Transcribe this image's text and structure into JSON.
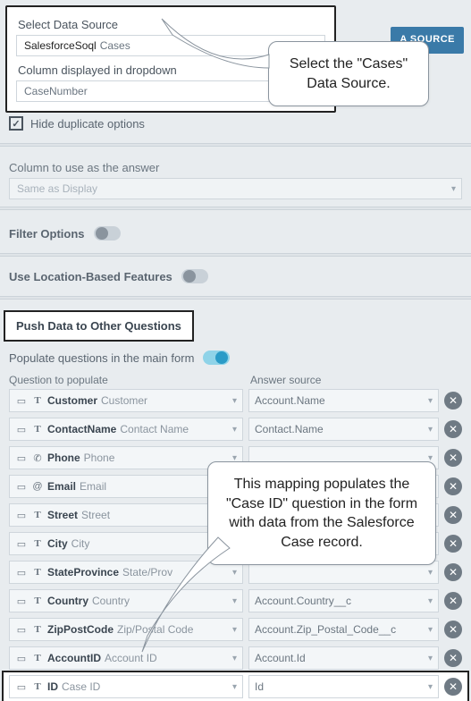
{
  "topbar": {
    "button": "A SOURCE"
  },
  "dataSourcePanel": {
    "label1": "Select Data Source",
    "prefix": "SalesforceSoql",
    "value": "Cases",
    "label2": "Column displayed in dropdown",
    "column": "CaseNumber"
  },
  "hideDup": {
    "label": "Hide duplicate options"
  },
  "answerCol": {
    "label": "Column to use as the answer",
    "value": "Same as Display"
  },
  "filterOptions": {
    "label": "Filter Options"
  },
  "locationFeatures": {
    "label": "Use Location-Based Features"
  },
  "pushTab": {
    "label": "Push Data to Other Questions"
  },
  "populate": {
    "label": "Populate questions in the main form",
    "colL": "Question to populate",
    "colR": "Answer source"
  },
  "mappings": [
    {
      "icon": "T",
      "name": "Customer",
      "sub": "Customer",
      "answer": "Account.Name"
    },
    {
      "icon": "T",
      "name": "ContactName",
      "sub": "Contact Name",
      "answer": "Contact.Name"
    },
    {
      "icon": "phone",
      "name": "Phone",
      "sub": "Phone",
      "answer": ""
    },
    {
      "icon": "@",
      "name": "Email",
      "sub": "Email",
      "answer": ""
    },
    {
      "icon": "T",
      "name": "Street",
      "sub": "Street",
      "answer": ""
    },
    {
      "icon": "T",
      "name": "City",
      "sub": "City",
      "answer": ""
    },
    {
      "icon": "T",
      "name": "StateProvince",
      "sub": "State/Prov",
      "answer": ""
    },
    {
      "icon": "T",
      "name": "Country",
      "sub": "Country",
      "answer": "Account.Country__c"
    },
    {
      "icon": "T",
      "name": "ZipPostCode",
      "sub": "Zip/Postal Code",
      "answer": "Account.Zip_Postal_Code__c"
    },
    {
      "icon": "T",
      "name": "AccountID",
      "sub": "Account ID",
      "answer": "Account.Id"
    },
    {
      "icon": "T",
      "name": "ID",
      "sub": "Case ID",
      "answer": "Id",
      "highlight": true
    }
  ],
  "callout1": "Select the \"Cases\" Data Source.",
  "callout2": "This mapping populates the \"Case ID\" question in the form with data from the Salesforce Case record."
}
